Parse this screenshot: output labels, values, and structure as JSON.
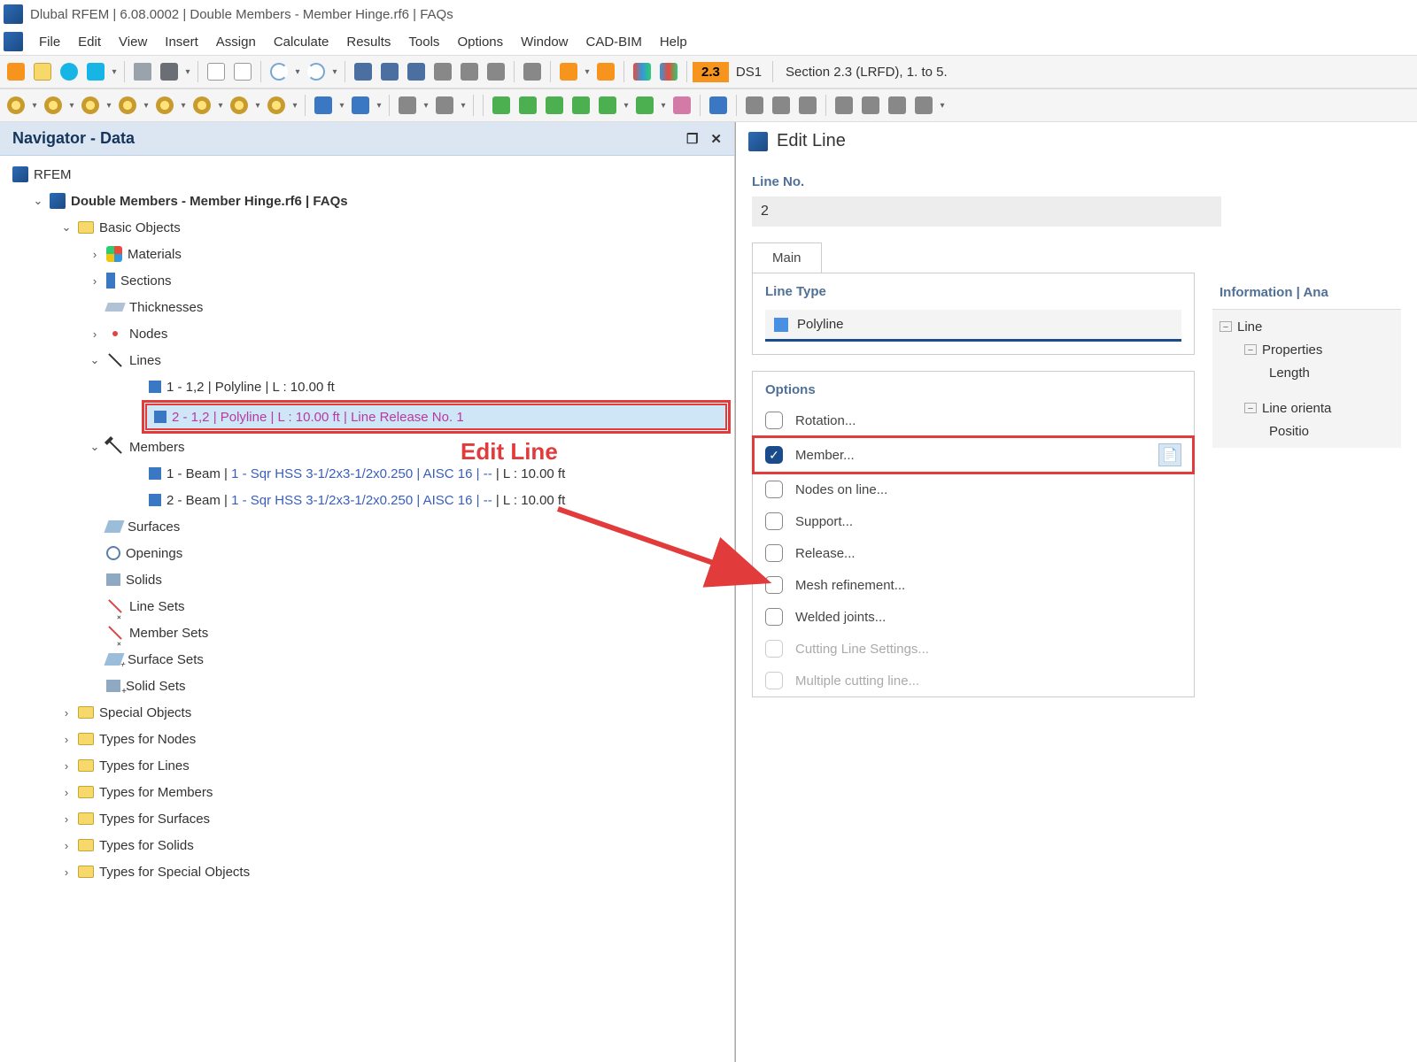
{
  "title": "Dlubal RFEM | 6.08.0002 | Double Members - Member Hinge.rf6 | FAQs",
  "menu": [
    "File",
    "Edit",
    "View",
    "Insert",
    "Assign",
    "Calculate",
    "Results",
    "Tools",
    "Options",
    "Window",
    "CAD-BIM",
    "Help"
  ],
  "toolbar1": {
    "badge": "2.3",
    "ds": "DS1",
    "section": "Section 2.3 (LRFD), 1. to 5."
  },
  "navigator": {
    "title": "Navigator - Data",
    "root": "RFEM",
    "model": "Double Members - Member Hinge.rf6 | FAQs",
    "basic": "Basic Objects",
    "materials": "Materials",
    "sections": "Sections",
    "thicknesses": "Thicknesses",
    "nodes": "Nodes",
    "lines": "Lines",
    "line1": "1 - 1,2 | Polyline | L : 10.00 ft",
    "line2": "2 - 1,2 | Polyline | L : 10.00 ft | Line Release No. 1",
    "members": "Members",
    "member1_a": "1 - Beam | ",
    "member1_b": "1 - Sqr HSS 3-1/2x3-1/2x0.250 | AISC 16 | --",
    "member1_c": " | L : 10.00 ft",
    "member2_a": "2 - Beam | ",
    "member2_b": "1 - Sqr HSS 3-1/2x3-1/2x0.250 | AISC 16 | --",
    "member2_c": " | L : 10.00 ft",
    "surfaces": "Surfaces",
    "openings": "Openings",
    "solids": "Solids",
    "linesets": "Line Sets",
    "membersets": "Member Sets",
    "surfacesets": "Surface Sets",
    "solidsets": "Solid Sets",
    "special": "Special Objects",
    "tnodes": "Types for Nodes",
    "tlines": "Types for Lines",
    "tmembers": "Types for Members",
    "tsurfaces": "Types for Surfaces",
    "tsolids": "Types for Solids",
    "tspecial": "Types for Special Objects"
  },
  "annot": {
    "editline": "Edit Line"
  },
  "edit": {
    "title": "Edit Line",
    "lineno_lbl": "Line No.",
    "lineno_val": "2",
    "tab_main": "Main",
    "linetype_lbl": "Line Type",
    "linetype_val": "Polyline",
    "options_lbl": "Options",
    "opts": {
      "rotation": "Rotation...",
      "member": "Member...",
      "nodesonline": "Nodes on line...",
      "support": "Support...",
      "release": "Release...",
      "meshref": "Mesh refinement...",
      "welded": "Welded joints...",
      "cutset": "Cutting Line Settings...",
      "multicut": "Multiple cutting line..."
    },
    "info": {
      "title": "Information | Ana",
      "line": "Line",
      "props": "Properties",
      "length": "Length",
      "orient": "Line orienta",
      "position": "Positio"
    }
  }
}
